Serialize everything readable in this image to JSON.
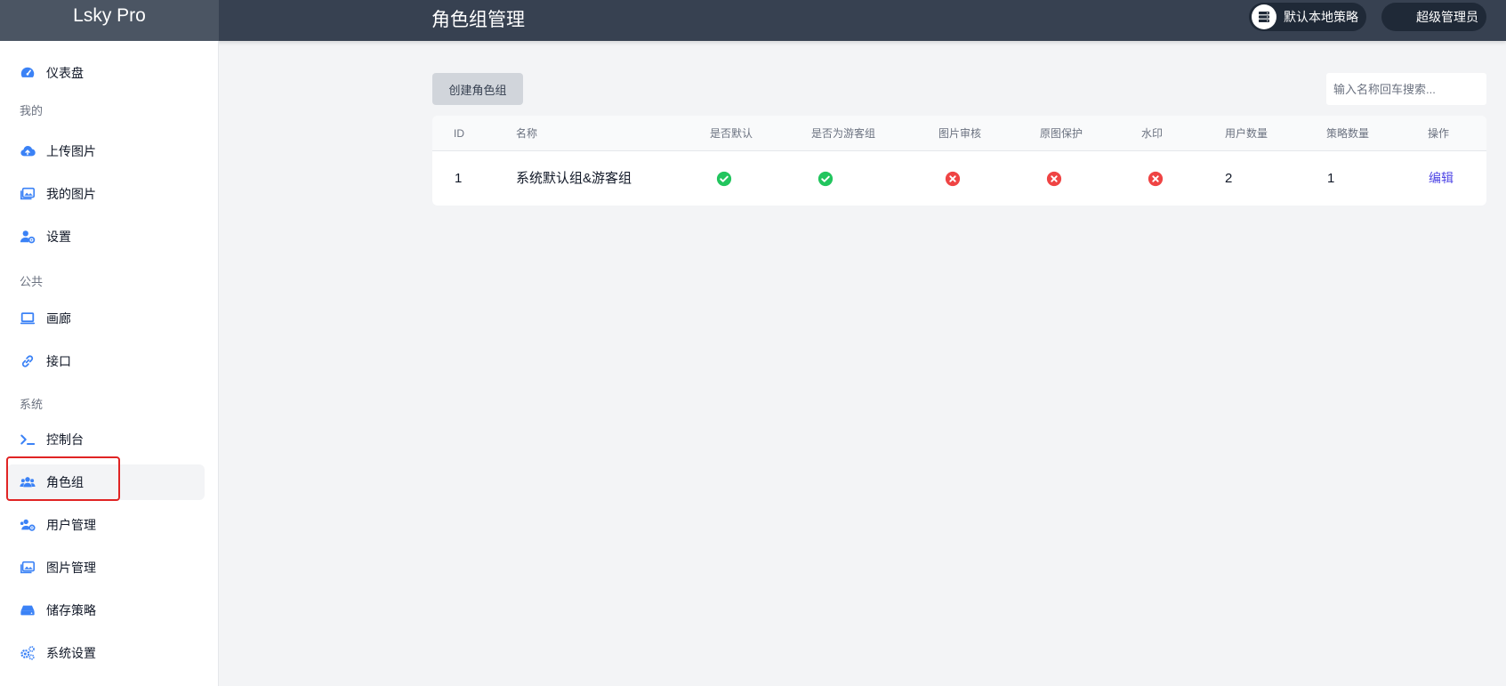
{
  "app": {
    "brand": "Lsky Pro",
    "page_title": "角色组管理"
  },
  "header": {
    "strategy_label": "默认本地策略",
    "user_label": "超级管理员"
  },
  "sidebar": {
    "dashboard": "仪表盘",
    "sections": [
      "我的",
      "公共",
      "系统"
    ],
    "mine": [
      "上传图片",
      "我的图片",
      "设置"
    ],
    "public": [
      "画廊",
      "接口"
    ],
    "system": [
      "控制台",
      "角色组",
      "用户管理",
      "图片管理",
      "储存策略",
      "系统设置"
    ],
    "active": "角色组"
  },
  "toolbar": {
    "create_label": "创建角色组",
    "search_placeholder": "输入名称回车搜索..."
  },
  "table": {
    "headers": [
      "ID",
      "名称",
      "是否默认",
      "是否为游客组",
      "图片审核",
      "原图保护",
      "水印",
      "用户数量",
      "策略数量",
      "操作"
    ],
    "rows": [
      {
        "id": "1",
        "name": "系统默认组&游客组",
        "is_default": true,
        "is_guest": true,
        "image_review": false,
        "original_protect": false,
        "watermark": false,
        "user_count": "2",
        "strategy_count": "1",
        "action": "编辑"
      }
    ]
  },
  "colors": {
    "check": "#22c55e",
    "cross": "#ef4444",
    "icon_blue": "#3b82f6",
    "link": "#4f46e5"
  }
}
